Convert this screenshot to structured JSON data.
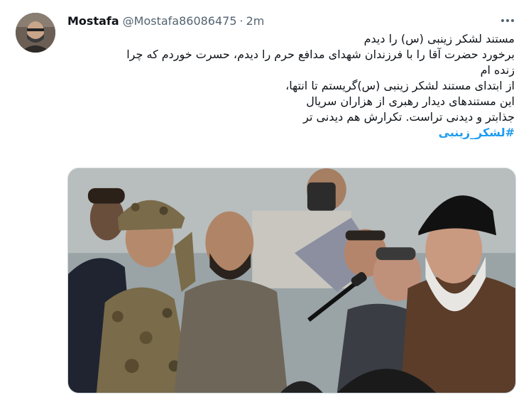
{
  "tweet": {
    "display_name": "Mostafa",
    "handle": "@Mostafa86086475",
    "separator": "·",
    "time": "2m",
    "lines": [
      "مستند لشکر زینبی (س) را دیدم",
      "برخورد حضرت آقا را با فرزندان شهدای مدافع حرم را دیدم، حسرت خوردم که چرا",
      "زنده ام",
      "از ابتدای مستند لشکر زینبی (س)گریستم تا انتها،",
      "این مستندهای دیدار رهبری از هزاران سریال",
      "جذابتر و دیدنی تراست. تکرارش هم دیدنی تر"
    ],
    "hashtag": "#لشکر_زینبی"
  },
  "colors": {
    "text": "#0f1419",
    "secondary": "#536471",
    "link": "#1d9bf0",
    "border": "#cfd9de"
  },
  "icons": {
    "more": "more-horizontal-icon"
  }
}
